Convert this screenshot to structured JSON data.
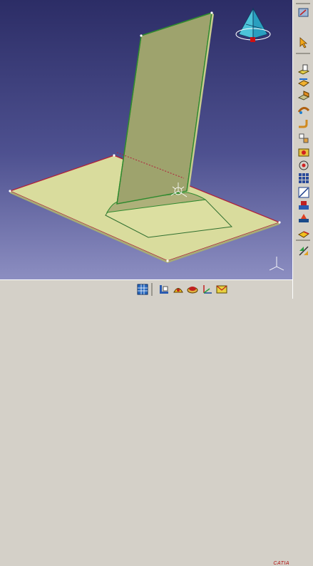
{
  "app": {
    "logo_text": "CATIA",
    "colors": {
      "background_top": "#2c2d66",
      "background_bottom": "#8c8ec1",
      "part_face": "#d8dc9c",
      "part_wall": "#9ea36d",
      "edge_highlight": "#b0203a",
      "tangent_edge": "#2f8a2f"
    }
  },
  "viewport": {
    "compass": "compass-icon",
    "axis_triad": "axis-triad-icon"
  },
  "right_toolbar": {
    "items": [
      {
        "name": "sheet-metal-parameters-icon"
      },
      {
        "name": "select-arrow-icon"
      },
      {
        "name": "wall-icon"
      },
      {
        "name": "wall-on-edge-icon"
      },
      {
        "name": "extrusion-icon"
      },
      {
        "name": "swept-wall-icon"
      },
      {
        "name": "bend-icon"
      },
      {
        "name": "unfold-icon"
      },
      {
        "name": "cutout-icon"
      },
      {
        "name": "hole-icon"
      },
      {
        "name": "rectangular-pattern-icon"
      },
      {
        "name": "sketch-icon"
      },
      {
        "name": "stamp-icon"
      },
      {
        "name": "user-stamp-icon"
      },
      {
        "name": "corner-relief-icon"
      },
      {
        "name": "transformation-icon"
      }
    ]
  },
  "bottom_toolbar": {
    "items": [
      {
        "name": "snap-grid-icon"
      },
      {
        "name": "material-icon"
      },
      {
        "name": "knowledge-icon"
      },
      {
        "name": "measure-icon"
      },
      {
        "name": "axis-system-icon"
      },
      {
        "name": "catalog-icon"
      }
    ]
  }
}
